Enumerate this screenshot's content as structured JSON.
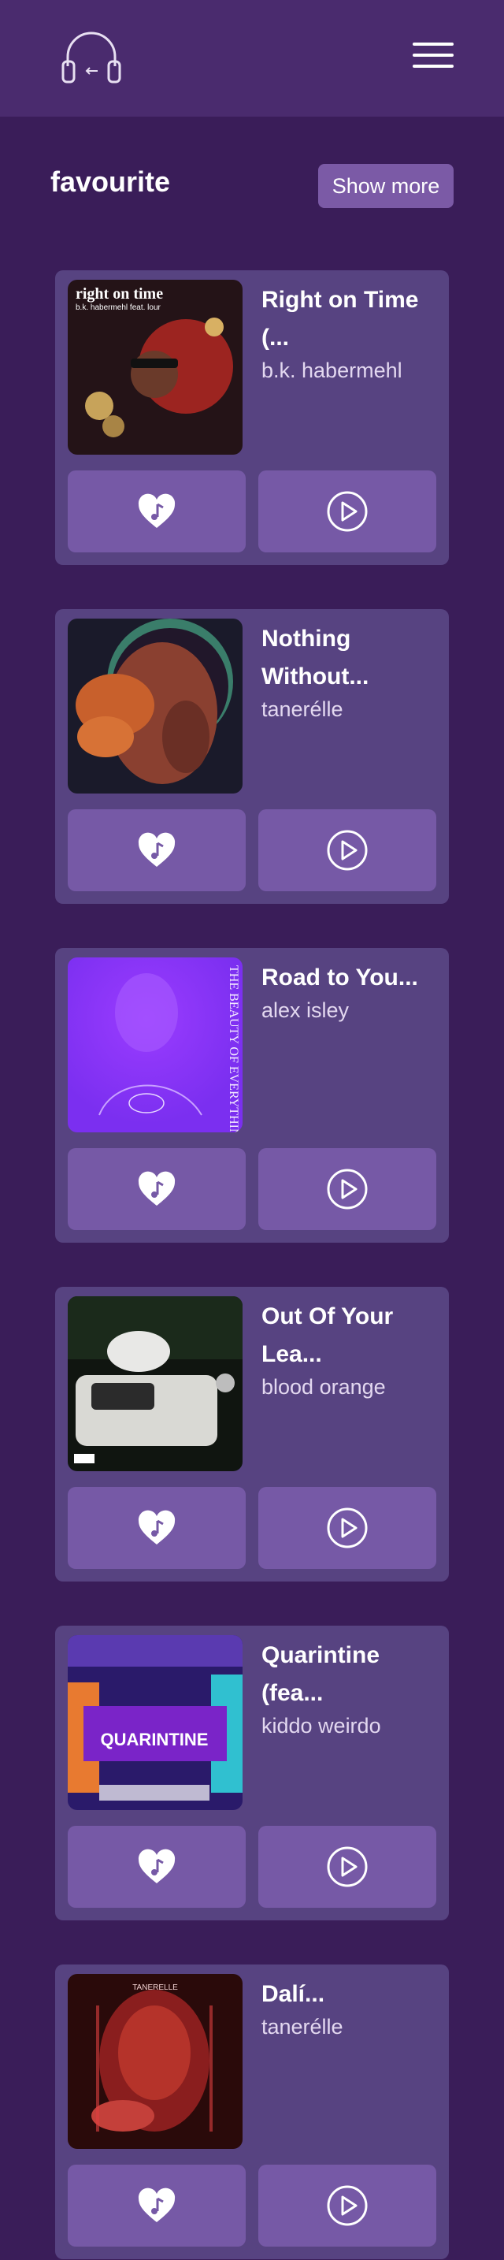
{
  "header": {
    "logo_icon": "headphones-icon",
    "menu_icon": "hamburger-menu-icon"
  },
  "section": {
    "title": "favourite",
    "show_more_label": "Show more"
  },
  "songs": [
    {
      "title_line1": "Right on Time",
      "title_line2": "(...",
      "artist": "b.k. habermehl",
      "art_text": "right on time",
      "art_sub": "b.k. habermehl feat. lour"
    },
    {
      "title_line1": "Nothing",
      "title_line2": "Without...",
      "artist": "tanerélle",
      "art_text": "",
      "art_sub": ""
    },
    {
      "title_line1": "Road to You...",
      "title_line2": "",
      "artist": "alex isley",
      "art_text": "THE BEAUTY OF EVERYTHING",
      "art_sub": ""
    },
    {
      "title_line1": "Out Of Your",
      "title_line2": "Lea...",
      "artist": "blood orange",
      "art_text": "",
      "art_sub": ""
    },
    {
      "title_line1": "Quarintine",
      "title_line2": "(fea...",
      "artist": "kiddo weirdo",
      "art_text": "QUARINTINE",
      "art_sub": ""
    },
    {
      "title_line1": "Dalí...",
      "title_line2": "",
      "artist": "tanerélle",
      "art_text": "TANERELLE",
      "art_sub": ""
    }
  ],
  "icons": {
    "favourite": "heart-music-icon",
    "play": "play-circle-icon"
  },
  "colors": {
    "background": "#3a1d59",
    "header": "#4a2b6e",
    "card": "#574381",
    "button": "#7659a6"
  }
}
